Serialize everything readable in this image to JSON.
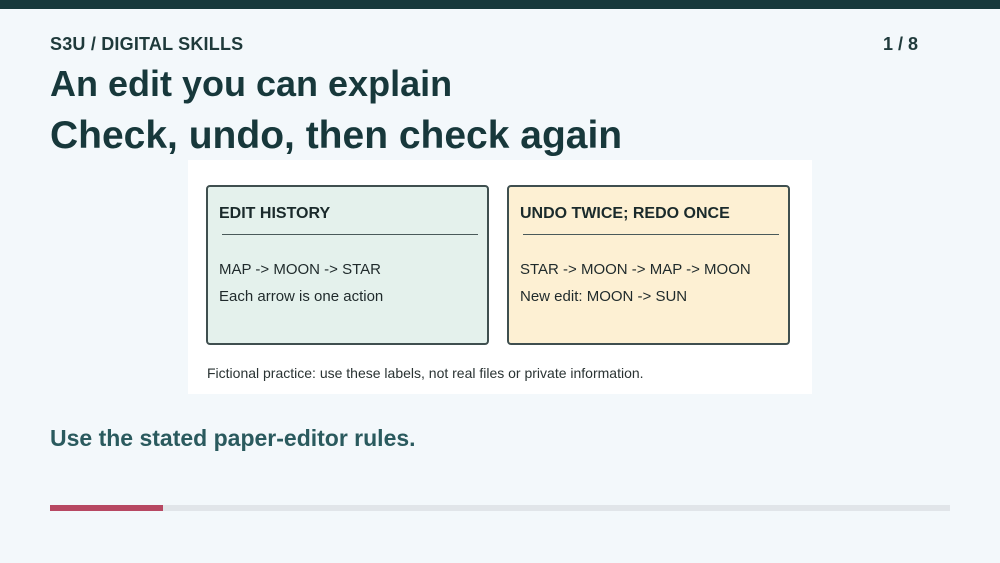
{
  "header": {
    "course_label": "S3U / DIGITAL SKILLS",
    "page_counter": "1 / 8"
  },
  "slide": {
    "title": "An edit you can explain",
    "subtitle": "Check, undo, then check again"
  },
  "figure": {
    "left_panel": {
      "heading": "EDIT HISTORY",
      "lines": [
        "MAP -> MOON -> STAR",
        "Each arrow is one action"
      ]
    },
    "right_panel": {
      "heading": "UNDO TWICE; REDO ONCE",
      "lines": [
        "STAR -> MOON -> MAP -> MOON",
        "New edit: MOON -> SUN"
      ]
    },
    "note": "Fictional practice: use these labels, not real files or private information."
  },
  "footer": {
    "rules_note": "Use the stated paper-editor rules."
  },
  "progress": {
    "current": 1,
    "total": 8
  },
  "colors": {
    "top_bar": "#17383b",
    "progress_fill": "#b74862",
    "left_panel_bg": "#e4f1ec",
    "right_panel_bg": "#fdf0d3"
  }
}
